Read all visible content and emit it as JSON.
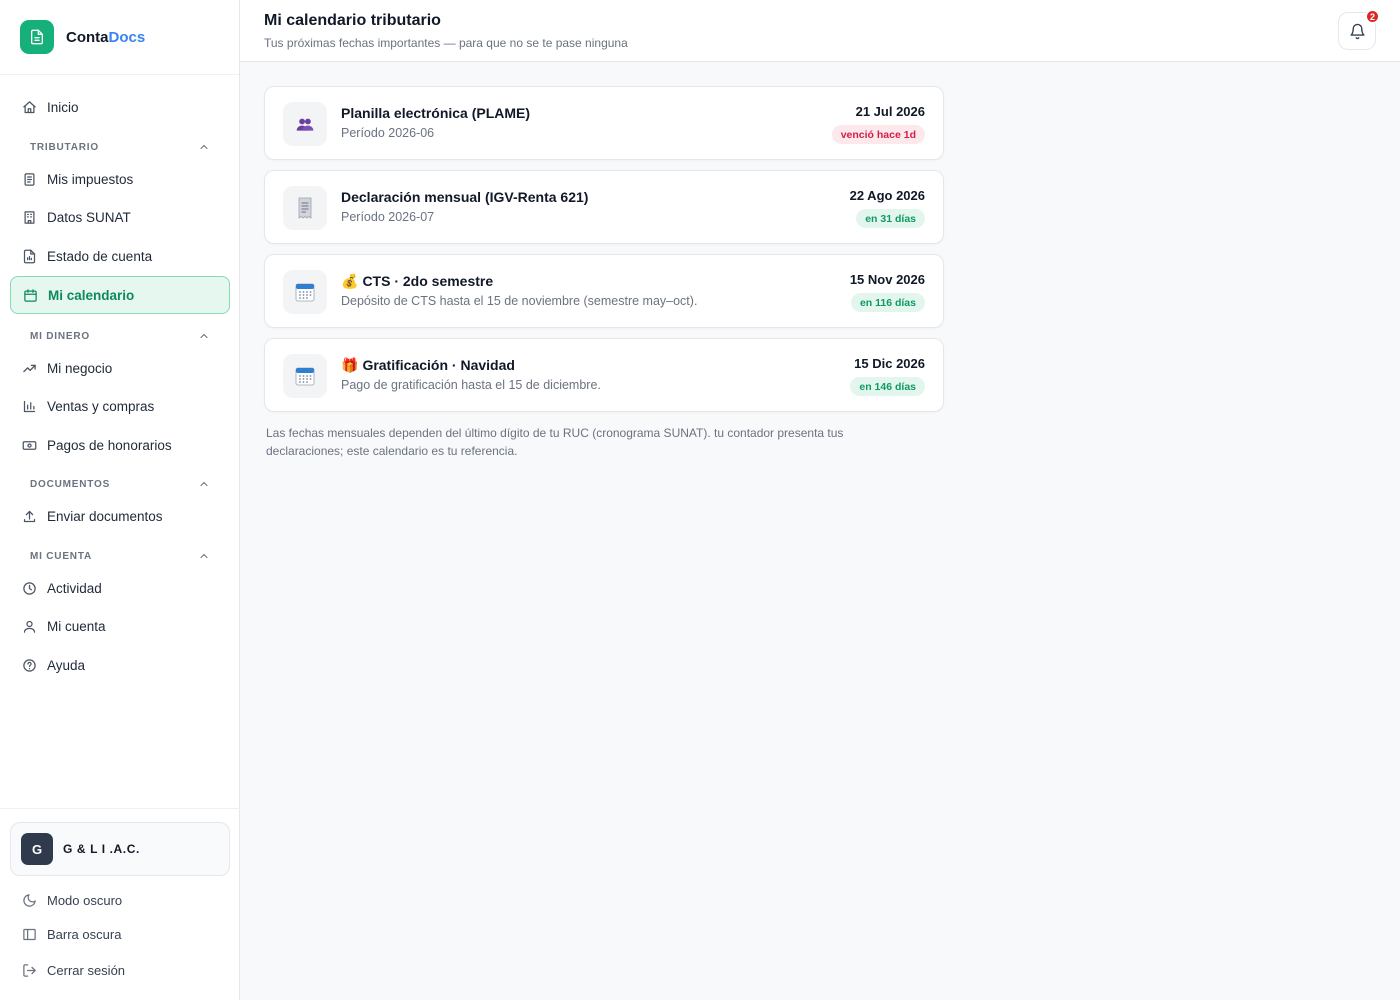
{
  "brand": {
    "name_part1": "Conta",
    "name_part2": "Docs",
    "color": "#16b07a"
  },
  "header": {
    "title": "Mi calendario tributario",
    "subtitle": "Tus próximas fechas importantes — para que no se te pase ninguna",
    "notifications_count": "2"
  },
  "sidebar": {
    "home": "Inicio",
    "sections": [
      {
        "label": "TRIBUTARIO",
        "items": [
          "Mis impuestos",
          "Datos SUNAT",
          "Estado de cuenta",
          "Mi calendario"
        ]
      },
      {
        "label": "MI DINERO",
        "items": [
          "Mi negocio",
          "Ventas y compras",
          "Pagos de honorarios"
        ]
      },
      {
        "label": "DOCUMENTOS",
        "items": [
          "Enviar documentos"
        ]
      },
      {
        "label": "MI CUENTA",
        "items": [
          "Actividad",
          "Mi cuenta",
          "Ayuda"
        ]
      }
    ],
    "active_item": "Mi calendario"
  },
  "footer": {
    "org_initial": "G",
    "org_name": "G & L I                 .A.C.",
    "dark_mode": "Modo oscuro",
    "dark_sidebar": "Barra oscura",
    "logout": "Cerrar sesión"
  },
  "events": [
    {
      "icon": "people-icon",
      "emoji": "",
      "title": "Planilla electrónica (PLAME)",
      "desc": "Período 2026-06",
      "date": "21 Jul 2026",
      "status": "venció hace 1d",
      "status_type": "overdue"
    },
    {
      "icon": "receipt-icon",
      "emoji": "",
      "title": "Declaración mensual (IGV-Renta 621)",
      "desc": "Período 2026-07",
      "date": "22 Ago 2026",
      "status": "en 31 días",
      "status_type": "upcoming"
    },
    {
      "icon": "calendar-icon",
      "emoji": "💰",
      "title": "CTS · 2do semestre",
      "desc": "Depósito de CTS hasta el 15 de noviembre (semestre may–oct).",
      "date": "15 Nov 2026",
      "status": "en 116 días",
      "status_type": "upcoming"
    },
    {
      "icon": "calendar-icon",
      "emoji": "🎁",
      "title": "Gratificación · Navidad",
      "desc": "Pago de gratificación hasta el 15 de diciembre.",
      "date": "15 Dic 2026",
      "status": "en 146 días",
      "status_type": "upcoming"
    }
  ],
  "note": "Las fechas mensuales dependen del último dígito de tu RUC (cronograma SUNAT). tu contador presenta tus declaraciones; este calendario es tu referencia."
}
